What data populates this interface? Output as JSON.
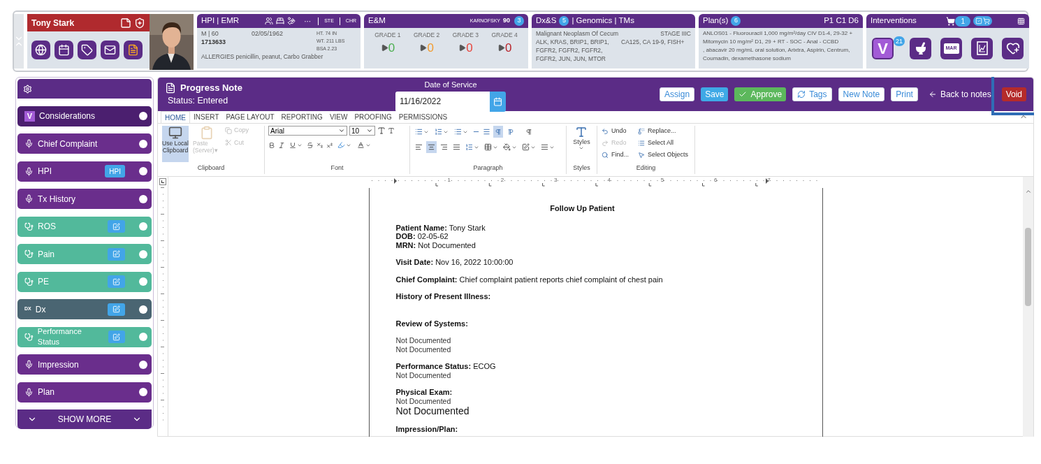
{
  "patient": {
    "name": "Tony Stark"
  },
  "hpi": {
    "title": "HPI | EMR",
    "more": "···",
    "ste": "STE",
    "chr": "CHR",
    "sex_age": "M | 60",
    "dob": "02/05/1962",
    "mrn": "1713633",
    "height": "HT. 74 IN",
    "weight": "WT. 211 LBS",
    "bsa": "BSA 2.23",
    "allergies": "ALLERGIES penicillin, peanut, Carbo Grabber"
  },
  "em": {
    "title": "E&M",
    "karnofsky_label": "KARNOFSKY",
    "karnofsky": "90",
    "badge": "3",
    "grades": [
      {
        "label": "GRADE 1",
        "count": "0",
        "color": "#4caf50"
      },
      {
        "label": "GRADE 2",
        "count": "0",
        "color": "#f29b2e"
      },
      {
        "label": "GRADE 3",
        "count": "0",
        "color": "#e8453c"
      },
      {
        "label": "GRADE 4",
        "count": "0",
        "color": "#b8232a"
      }
    ]
  },
  "dx": {
    "title": "Dx&S",
    "badge": "5",
    "title_rest": "| Genomics | TMs",
    "diagnosis": "Malignant Neoplasm Of Cecum",
    "stage": "STAGE IIIC",
    "markers": "ALK, KRAS, BRIP1, BRIP1, FGFR2, FGFR2, FGFR2, FGFR2, JUN, JUN, MTOR",
    "markers_right": "CA125, CA 19-9, FISH+"
  },
  "plan": {
    "title": "Plan(s)",
    "badge": "6",
    "cycle": "P1 C1 D6",
    "regimen": "ANLOS01 - Fluorouracil 1,000 mg/m²/day CIV D1-4, 29-32 + Mitomycin 10 mg/m² D1, 29 + RT - SOC - Anal - CCBD",
    "meds": ", abacavir 20 mg/mL oral solution, Arixtra, Aspirin, Centrum, Coumadin, dexamethasone sodium"
  },
  "interventions": {
    "title": "Interventions",
    "cart_count": "1",
    "v_label": "V",
    "v_badge": "21",
    "mar": "MAR"
  },
  "sidebar": {
    "items": [
      {
        "label": "Considerations",
        "kind": "letter",
        "icon_text": "V",
        "color": "#4b1f6f"
      },
      {
        "label": "Chief Complaint",
        "kind": "mic",
        "color": "#6a2e8c"
      },
      {
        "label": "HPI",
        "kind": "mic",
        "badge": "HPI",
        "color": "#6a2e8c"
      },
      {
        "label": "Tx History",
        "kind": "mic",
        "color": "#6a2e8c"
      },
      {
        "label": "ROS",
        "kind": "stethoscope",
        "editable": true,
        "color": "#52b99b"
      },
      {
        "label": "Pain",
        "kind": "stethoscope",
        "editable": true,
        "color": "#52b99b"
      },
      {
        "label": "PE",
        "kind": "stethoscope",
        "editable": true,
        "color": "#52b99b"
      },
      {
        "label": "Dx",
        "kind": "letter",
        "icon_text": "DX",
        "editable": true,
        "color": "#4a6572"
      },
      {
        "label": "Performance Status",
        "kind": "stethoscope",
        "editable": true,
        "color": "#52b99b"
      },
      {
        "label": "Impression",
        "kind": "mic",
        "color": "#6a2e8c"
      },
      {
        "label": "Plan",
        "kind": "mic",
        "color": "#6a2e8c"
      }
    ],
    "show_more": "SHOW MORE"
  },
  "note_header": {
    "title": "Progress Note",
    "status": "Status: Entered",
    "date_label": "Date of Service",
    "date": "11/16/2022",
    "buttons": [
      {
        "label": "Assign",
        "kind": "outline"
      },
      {
        "label": "Save",
        "kind": "primary"
      },
      {
        "label": "Approve",
        "kind": "approve"
      },
      {
        "label": "Tags",
        "kind": "tags"
      },
      {
        "label": "New Note",
        "kind": "outline"
      },
      {
        "label": "Print",
        "kind": "outline"
      },
      {
        "label": "Back to notes",
        "kind": "back"
      },
      {
        "label": "Void",
        "kind": "danger",
        "highlighted": true
      }
    ]
  },
  "ribbon": {
    "tabs": [
      {
        "label": "HOME",
        "selected": true
      },
      {
        "label": "INSERT",
        "selected": false
      },
      {
        "label": "PAGE LAYOUT",
        "selected": false
      },
      {
        "label": "REPORTING",
        "selected": false
      },
      {
        "label": "VIEW",
        "selected": false
      },
      {
        "label": "PROOFING",
        "selected": false
      },
      {
        "label": "PERMISSIONS",
        "selected": false
      }
    ],
    "clipboard": {
      "label": "Clipboard",
      "local": {
        "label": "Use Local Clipboard",
        "selected": true
      },
      "paste": {
        "label": "Paste",
        "sub": "(Server)▾",
        "disabled": true
      },
      "copy": {
        "label": "Copy",
        "disabled": true
      },
      "cut": {
        "label": "Cut",
        "disabled": true
      }
    },
    "font": {
      "label": "Font",
      "family": "Arial",
      "size": "10"
    },
    "paragraph": {
      "label": "Paragraph",
      "direction": [
        {
          "kind": "ltr",
          "selected": true
        },
        {
          "kind": "rtl",
          "selected": false
        }
      ],
      "align": [
        {
          "kind": "left",
          "selected": false
        },
        {
          "kind": "center",
          "selected": true
        },
        {
          "kind": "right",
          "selected": false
        },
        {
          "kind": "justify",
          "selected": false
        }
      ]
    },
    "styles": {
      "label": "Styles",
      "button": "Styles"
    },
    "editing": {
      "label": "Editing",
      "items": [
        {
          "label": "Undo",
          "kind": "undo",
          "disabled": false
        },
        {
          "label": "Redo",
          "kind": "redo",
          "disabled": true
        },
        {
          "label": "Find...",
          "kind": "find",
          "disabled": false
        },
        {
          "label": "Replace...",
          "kind": "replace",
          "disabled": false
        },
        {
          "label": "Select All",
          "kind": "select_all",
          "disabled": false
        },
        {
          "label": "Select Objects",
          "kind": "select_objects",
          "disabled": false
        }
      ]
    }
  },
  "ruler_numbers": [
    "1",
    "2",
    "3",
    "4",
    "5",
    "6",
    "7"
  ],
  "document": {
    "blocks": [
      [
        {
          "kind": "title",
          "text": "Follow Up Patient"
        }
      ],
      [
        {
          "kind": "field",
          "label": "Patient Name:",
          "value": "Tony Stark"
        },
        {
          "kind": "field",
          "label": "DOB:",
          "value": "02-05-62"
        },
        {
          "kind": "field",
          "label": "MRN:",
          "value": "Not Documented"
        }
      ],
      [
        {
          "kind": "field",
          "label": "Visit Date:",
          "value": "Nov 16, 2022 10:00:00"
        }
      ],
      [
        {
          "kind": "field",
          "label": "Chief Complaint:",
          "value": "Chief complaint patient reports chief complaint of chest pain"
        }
      ],
      [
        {
          "kind": "heading",
          "text": "History of Present Illness:"
        }
      ],
      [
        {
          "kind": "heading",
          "text": "Review of Systems:"
        }
      ],
      [
        {
          "kind": "plain",
          "text": "Not Documented"
        },
        {
          "kind": "plain",
          "text": "Not Documented"
        }
      ],
      [
        {
          "kind": "field",
          "label": "Performance Status:",
          "value": "ECOG"
        },
        {
          "kind": "plain",
          "text": "Not Documented"
        }
      ],
      [
        {
          "kind": "heading",
          "text": "Physical Exam:"
        },
        {
          "kind": "plain",
          "text": "Not Documented"
        },
        {
          "kind": "large",
          "text": "Not Documented"
        }
      ],
      [
        {
          "kind": "heading",
          "text": "Impression/Plan:"
        }
      ]
    ]
  }
}
